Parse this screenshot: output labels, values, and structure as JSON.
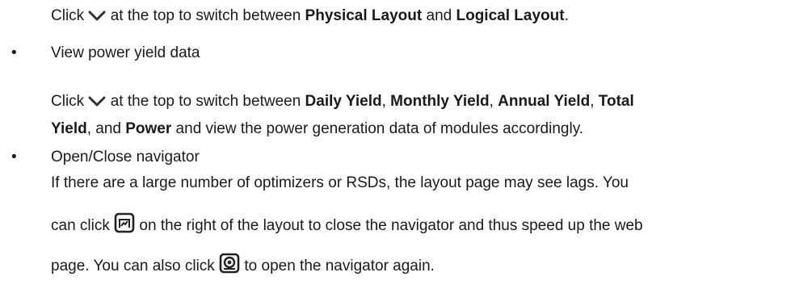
{
  "p1": {
    "t1": "Click ",
    "t2": " at the top to switch between ",
    "b1": "Physical Layout",
    "t3": " and ",
    "b2": "Logical Layout",
    "t4": "."
  },
  "bullet_char": "•",
  "item1": {
    "title": "View power yield data",
    "l1": {
      "t1": "Click ",
      "t2": " at the top to switch between ",
      "b1": "Daily Yield",
      "s1": ", ",
      "b2": "Monthly Yield",
      "s2": ", ",
      "b3": "Annual Yield",
      "s3": ", ",
      "b4": "Total"
    },
    "l2": {
      "b1": "Yield",
      "t1": ", and ",
      "b2": "Power",
      "t2": " and view the power generation data of modules accordingly."
    }
  },
  "item2": {
    "title": "Open/Close navigator",
    "l1": "If there are a large number of optimizers or RSDs, the layout page may see lags. You",
    "l2a": "can click ",
    "l2b": " on the right of the layout to close the navigator and thus speed up the web",
    "l3a": "page. You can also click ",
    "l3b": " to open the navigator again."
  },
  "icons": {
    "chevron": "chevron-down-icon",
    "close_navigator": "close-navigator-icon",
    "open_navigator": "open-navigator-icon"
  }
}
